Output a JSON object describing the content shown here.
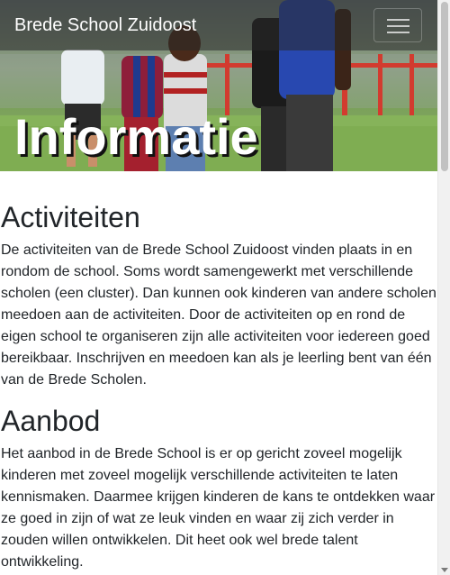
{
  "navbar": {
    "brand": "Brede School Zuidoost",
    "toggle_icon": "hamburger-menu-icon"
  },
  "hero": {
    "title": "Informatie"
  },
  "sections": [
    {
      "heading": "Activiteiten",
      "body": "De activiteiten van de Brede School Zuidoost vinden plaats in en rondom de school. Soms wordt samengewerkt met verschillende scholen (een cluster). Dan kunnen ook kinderen van andere scholen meedoen aan de activiteiten. Door de activiteiten op en rond de eigen school te organiseren zijn alle activiteiten voor iedereen goed bereikbaar. Inschrijven en meedoen kan als je leerling bent van één van de Brede Scholen."
    },
    {
      "heading": "Aanbod",
      "body": "Het aanbod in de Brede School is er op gericht zoveel mogelijk kinderen met zoveel mogelijk verschillende activiteiten te laten kennismaken. Daarmee krijgen kinderen de kans te ontdekken waar ze goed in zijn of wat ze leuk vinden en waar zij zich verder in zouden willen ontwikkelen. Dit heet ook wel brede talent ontwikkeling."
    }
  ]
}
